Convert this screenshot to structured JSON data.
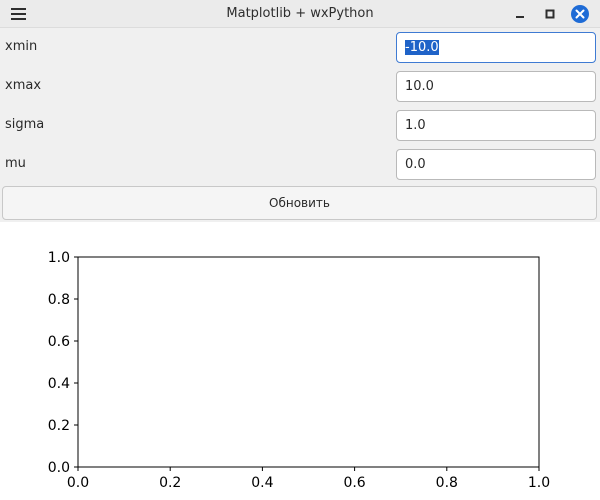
{
  "window": {
    "title": "Matplotlib + wxPython"
  },
  "icons": {
    "menu": "hamburger-menu-icon",
    "minimize": "minimize-icon",
    "maximize": "maximize-icon",
    "close": "close-icon",
    "close_color": "#1e6bd6"
  },
  "form": {
    "fields": [
      {
        "label": "xmin",
        "value": "-10.0"
      },
      {
        "label": "xmax",
        "value": "10.0"
      },
      {
        "label": "sigma",
        "value": "1.0"
      },
      {
        "label": "mu",
        "value": "0.0"
      }
    ],
    "update_label": "Обновить"
  },
  "chart_data": {
    "type": "line",
    "series": [],
    "xlim": [
      0.0,
      1.0
    ],
    "ylim": [
      0.0,
      1.0
    ],
    "xticks": [
      "0.0",
      "0.2",
      "0.4",
      "0.6",
      "0.8",
      "1.0"
    ],
    "yticks": [
      "0.0",
      "0.2",
      "0.4",
      "0.6",
      "0.8",
      "1.0"
    ],
    "grid": false
  }
}
